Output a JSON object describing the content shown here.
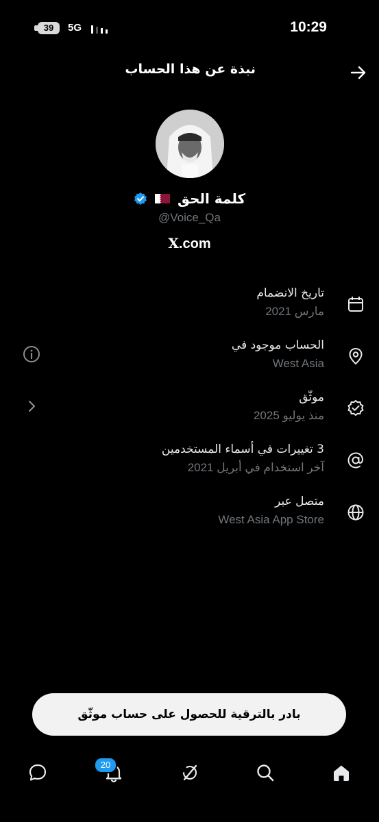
{
  "status_bar": {
    "time": "10:29",
    "battery": "39",
    "network": "5G"
  },
  "header": {
    "title": "نبذة عن هذا الحساب"
  },
  "profile": {
    "name": "كلمة الحق",
    "handle": "@Voice_Qa",
    "site_suffix": ".com",
    "site_logo": "X"
  },
  "info": [
    {
      "icon": "calendar-icon",
      "title": "تاريخ الانضمام",
      "subtitle": "مارس 2021"
    },
    {
      "icon": "location-pin-icon",
      "title": "الحساب موجود في",
      "subtitle": "West Asia"
    },
    {
      "icon": "verified-check-icon",
      "title": "موثّق",
      "subtitle": "منذ يوليو 2025"
    },
    {
      "icon": "at-sign-icon",
      "title": "3 تغييرات في أسماء المستخدمين",
      "subtitle": "آخر استخدام في أبريل 2021"
    },
    {
      "icon": "globe-icon",
      "title": "متصل عبر",
      "subtitle": "West Asia App Store"
    }
  ],
  "upgrade": {
    "label": "بادر بالترقية للحصول على حساب موثّق"
  },
  "nav": {
    "notification_count": "20"
  },
  "colors": {
    "background": "#000000",
    "primary_text": "#e7e9ea",
    "secondary_text": "#71767b",
    "accent": "#1d9bf0",
    "flag_maroon": "#8a1538"
  }
}
